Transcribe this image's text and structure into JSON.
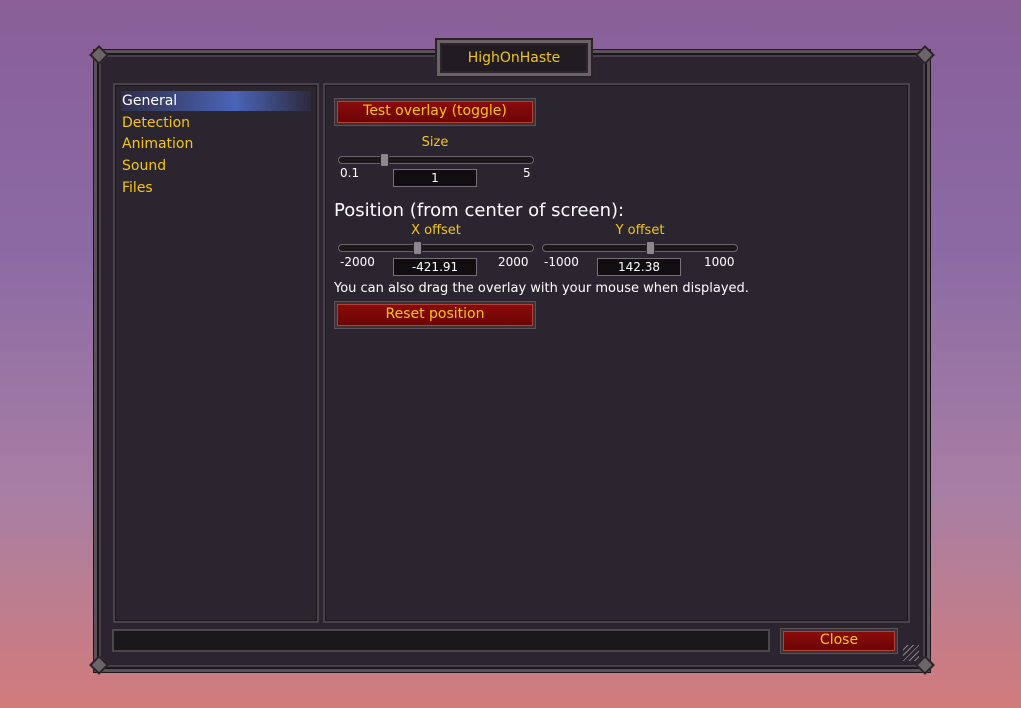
{
  "window": {
    "title": "HighOnHaste"
  },
  "sidebar": {
    "items": [
      {
        "label": "General",
        "selected": true
      },
      {
        "label": "Detection",
        "selected": false
      },
      {
        "label": "Animation",
        "selected": false
      },
      {
        "label": "Sound",
        "selected": false
      },
      {
        "label": "Files",
        "selected": false
      }
    ]
  },
  "general": {
    "test_overlay_button": "Test overlay (toggle)",
    "size": {
      "label": "Size",
      "min": "0.1",
      "max": "5",
      "value": "1"
    },
    "position_heading": "Position (from center of screen):",
    "x_offset": {
      "label": "X offset",
      "min": "-2000",
      "max": "2000",
      "value": "-421.91"
    },
    "y_offset": {
      "label": "Y offset",
      "min": "-1000",
      "max": "1000",
      "value": "142.38"
    },
    "drag_note": "You can also drag the overlay with your mouse when displayed.",
    "reset_button": "Reset position"
  },
  "footer": {
    "close_button": "Close"
  },
  "colors": {
    "accent": "#f3c51a",
    "button_red": "#7d0808",
    "panel": "#2b2530"
  }
}
